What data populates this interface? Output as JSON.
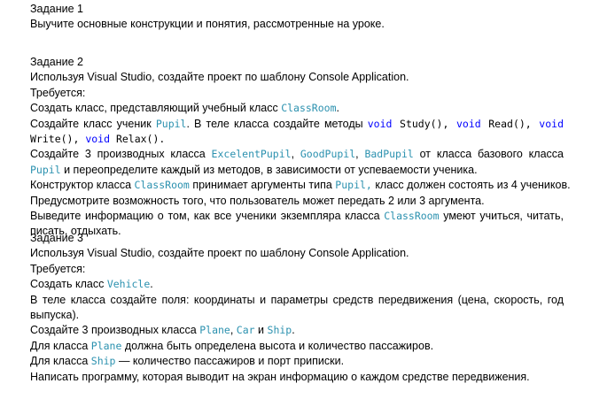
{
  "task1": {
    "heading": "Задание 1",
    "text": "Выучите основные конструкции  и понятия, рассмотренные на уроке."
  },
  "task2": {
    "heading": "Задание 2",
    "p1": "Используя Visual Studio, создайте проект по шаблону Console Application.",
    "p2": "Требуется:",
    "p3a": "Создать класс, представляющий учебный класс ",
    "p3_class": "ClassRoom",
    "p3b": ".",
    "p4a": "Создайте класс ученик ",
    "p4_class": "Pupil",
    "p4b": ".  В теле класса создайте методы ",
    "p4_void1": "void",
    "p4_m1": " Study(), ",
    "p4_void2": "void",
    "p4_m2": " Read(), ",
    "p4_void3": "void",
    "p4_m3": "Write(), ",
    "p4_void4": "void",
    "p4_m4": " Relax().",
    "p5a": "Создайте 3 производных класса ",
    "p5_c1": "ExcelentPupil",
    "p5_s1": ", ",
    "p5_c2": "GoodPupil",
    "p5_s2": ", ",
    "p5_c3": "BadPupil",
    "p5_b": "  от класса базового класса ",
    "p5_c4": "Pupil",
    "p5_c": " и переопределите каждый из методов, в зависимости от успеваемости ученика.",
    "p6a": "Конструктор класса ",
    "p6_c1": "ClassRoom",
    "p6b": " принимает аргументы типа ",
    "p6_c2": "Pupil,",
    "p6c": " класс должен состоять из 4 учеников.",
    "p7": "Предусмотрите возможность того, что пользователь может передать 2 или 3 аргумента.",
    "p8a": "Выведите информацию о том, как все ученики экземпляра класса ",
    "p8_c": "ClassRoom",
    "p8b": " умеют учиться, читать, писать, отдыхать."
  },
  "task3": {
    "heading": "Задание 3",
    "p1": "Используя Visual Studio, создайте проект по шаблону Console Application.",
    "p2": "Требуется:",
    "p3a": "Создать класс ",
    "p3_c": "Vehicle",
    "p3b": ".",
    "p4": "В теле класса создайте поля:  координаты и параметры средств передвижения (цена, скорость, год выпуска).",
    "p5a": "Создайте 3 производных класса ",
    "p5_c1": "Plane",
    "p5_s1": ", ",
    "p5_c2": "Car",
    "p5_s2": " и ",
    "p5_c3": "Ship",
    "p5b": ".",
    "p6a": "Для класса ",
    "p6_c": "Plane",
    "p6b": " должна быть определена высота и количество пассажиров.",
    "p7a": "Для класса ",
    "p7_c": "Ship",
    "p7b": " — количество пассажиров и порт приписки.",
    "p8": "Написать программу, которая выводит на экран информацию о каждом средстве передвижения."
  },
  "colors": {
    "class_name": "#2b91af",
    "keyword": "#0000ff",
    "text": "#000000",
    "background": "#ffffff"
  }
}
